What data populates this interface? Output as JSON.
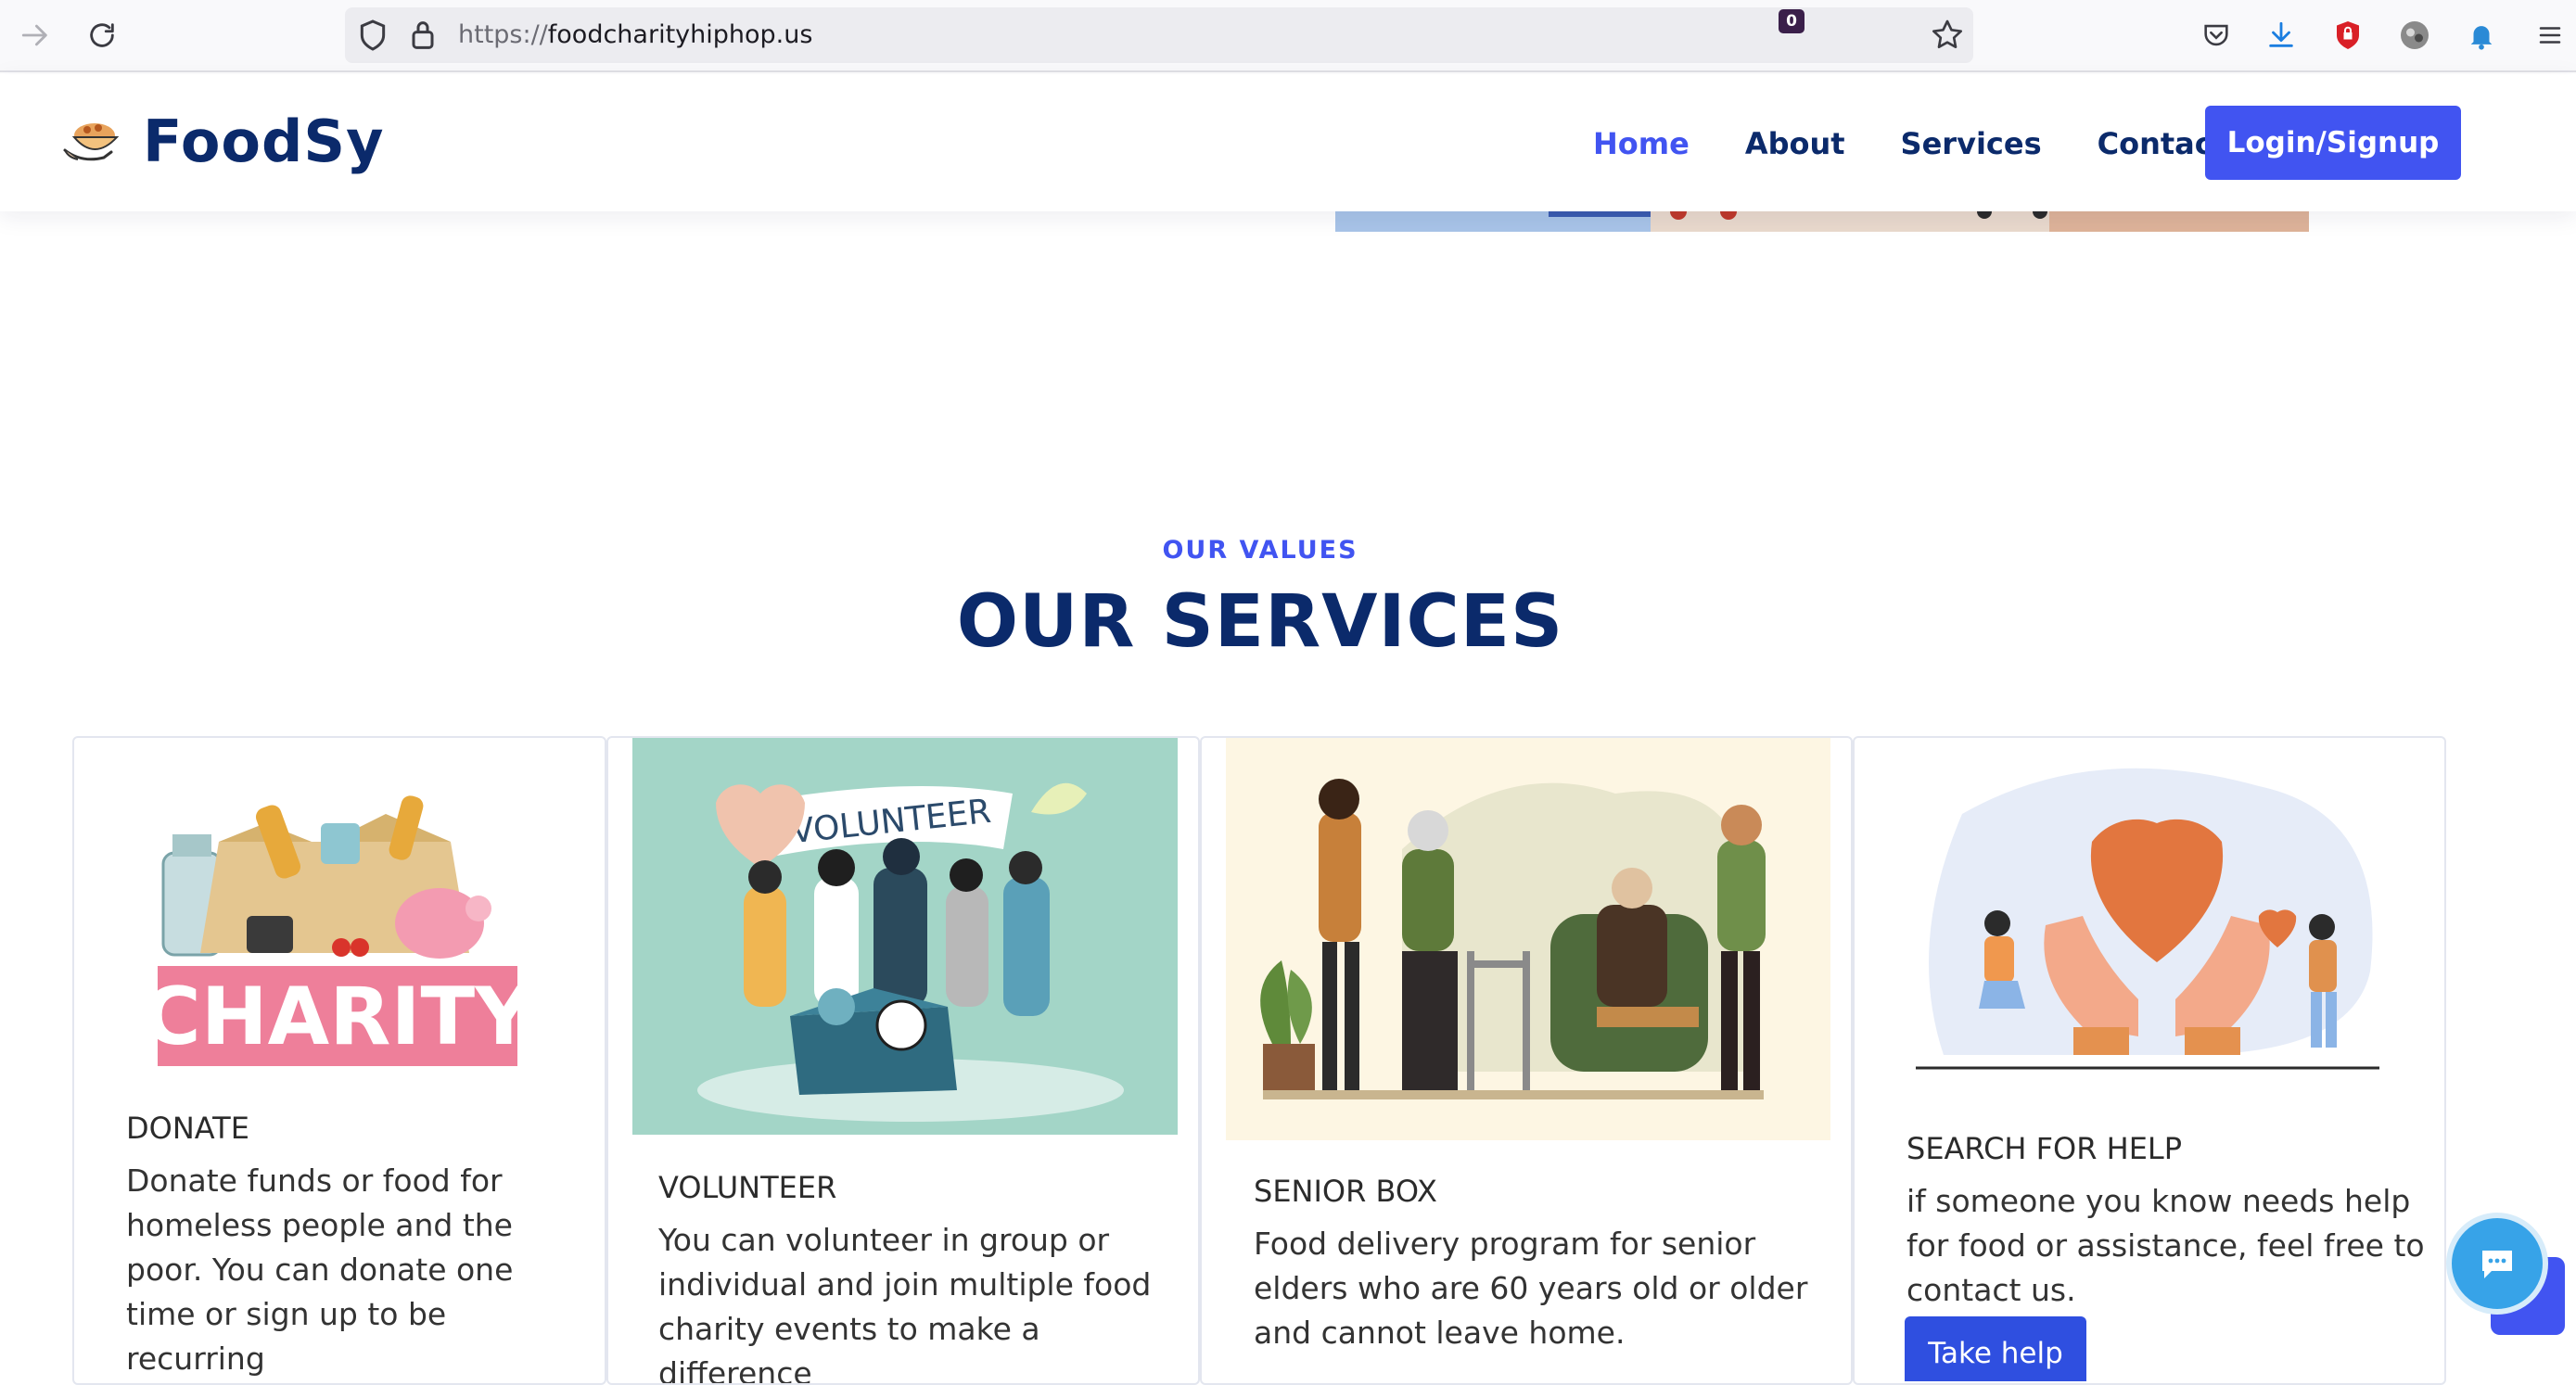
{
  "browser": {
    "url_protocol": "https://",
    "url_host": "foodcharityhiphop.us",
    "notification_count": "0"
  },
  "header": {
    "logo_text": "FoodSy",
    "nav": [
      {
        "label": "Home",
        "active": true
      },
      {
        "label": "About",
        "active": false
      },
      {
        "label": "Services",
        "active": false
      },
      {
        "label": "Contact",
        "active": false
      }
    ],
    "login_label": "Login/Signup",
    "accent_color": "#4154f1",
    "navy_color": "#0b2a6b"
  },
  "section": {
    "eyebrow": "OUR VALUES",
    "title": "OUR SERVICES"
  },
  "cards": [
    {
      "illustration": "charity-box-illustration",
      "image_caption": "CHARITY",
      "heading": "DONATE",
      "text": "Donate funds or food for homeless people and the poor. You can donate one time or sign up to be recurring"
    },
    {
      "illustration": "volunteer-group-illustration",
      "image_caption": "VOLUNTEER",
      "heading": "VOLUNTEER",
      "text": "You can volunteer in group or individual and join multiple food charity events to make a difference"
    },
    {
      "illustration": "senior-care-illustration",
      "heading": "SENIOR BOX",
      "text": "Food delivery program for senior elders who are 60 years old or older and cannot leave home."
    },
    {
      "illustration": "helping-hands-heart-illustration",
      "heading": "SEARCH FOR HELP",
      "text": "if someone you know needs help for food or assistance, feel free to contact us.",
      "button_label": "Take help"
    }
  ]
}
